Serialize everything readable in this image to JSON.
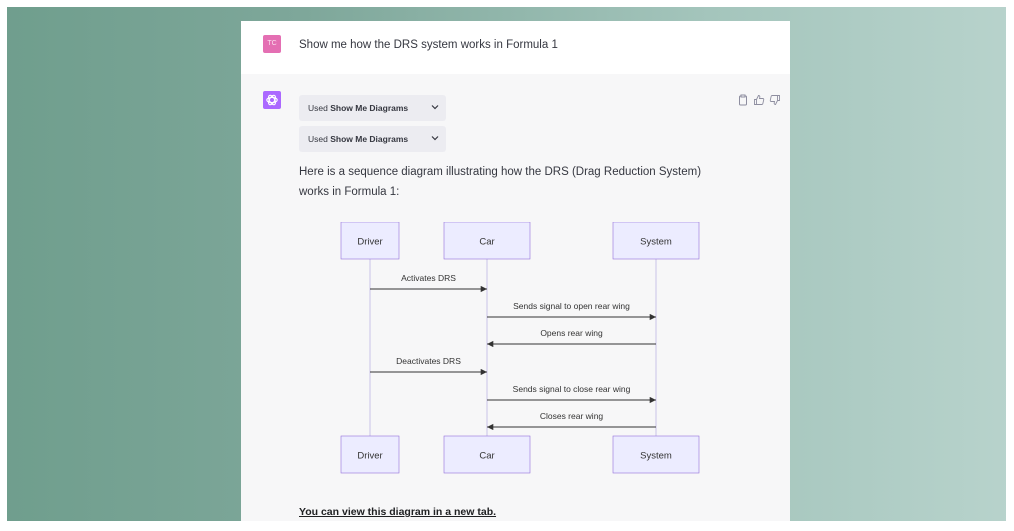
{
  "user_message": {
    "avatar_initials": "TC",
    "text": "Show me how the DRS system works in Formula 1"
  },
  "assistant": {
    "plugin_chips": [
      {
        "prefix": "Used",
        "name": "Show Me Diagrams"
      },
      {
        "prefix": "Used",
        "name": "Show Me Diagrams"
      }
    ],
    "answer": "Here is a sequence diagram illustrating how the DRS (Drag Reduction System) works in Formula 1:",
    "link": "You can view this diagram in a new tab.",
    "actions": [
      "copy-icon",
      "thumbs-up-icon",
      "thumbs-down-icon"
    ]
  },
  "diagram": {
    "participants": [
      "Driver",
      "Car",
      "System"
    ],
    "messages": [
      {
        "from": "Driver",
        "to": "Car",
        "label": "Activates DRS"
      },
      {
        "from": "Car",
        "to": "System",
        "label": "Sends signal to open rear wing"
      },
      {
        "from": "System",
        "to": "Car",
        "label": "Opens rear wing"
      },
      {
        "from": "Driver",
        "to": "Car",
        "label": "Deactivates DRS"
      },
      {
        "from": "Car",
        "to": "System",
        "label": "Sends signal to close rear wing"
      },
      {
        "from": "System",
        "to": "Car",
        "label": "Closes rear wing"
      }
    ]
  },
  "colors": {
    "participant_fill": "#ececff",
    "participant_stroke": "#9370db",
    "lifeline": "#c9c3e8",
    "arrow": "#333333"
  }
}
